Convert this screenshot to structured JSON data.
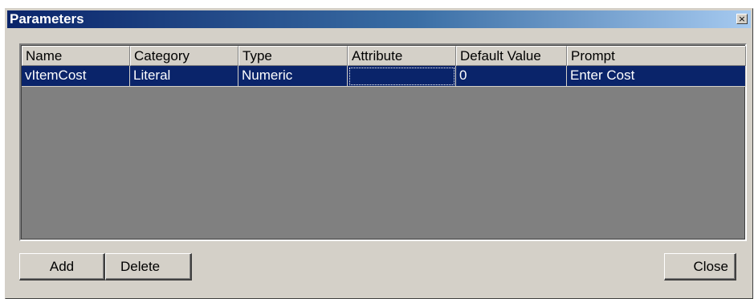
{
  "window": {
    "title": "Parameters",
    "close_glyph": "×"
  },
  "table": {
    "columns": [
      {
        "label": "Name"
      },
      {
        "label": "Category"
      },
      {
        "label": "Type"
      },
      {
        "label": "Attribute"
      },
      {
        "label": "Default Value"
      },
      {
        "label": "Prompt"
      }
    ],
    "rows": [
      {
        "name": "vItemCost",
        "category": "Literal",
        "type": "Numeric",
        "attribute": "",
        "default_value": "0",
        "prompt": "Enter Cost",
        "selected": true
      }
    ]
  },
  "buttons": {
    "add_label": "Add",
    "delete_label": "Delete",
    "close_label": "Close"
  },
  "colors": {
    "selection": "#0a246a",
    "face": "#d4d0c8",
    "grid_background": "#808080"
  }
}
